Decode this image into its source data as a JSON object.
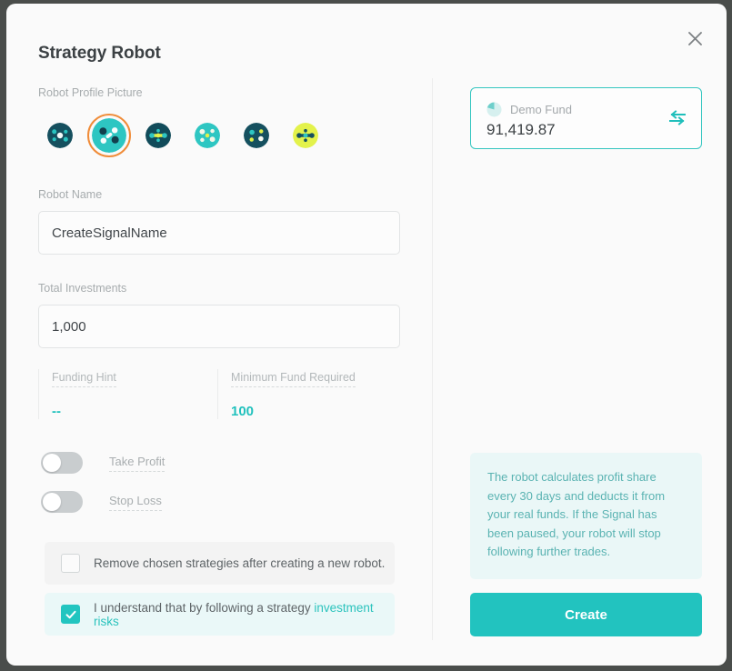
{
  "dialog": {
    "title": "Strategy Robot",
    "close_icon": "close-icon"
  },
  "left": {
    "avatar_section_label": "Robot Profile Picture",
    "avatars": [
      {
        "id": "avatar-1",
        "bg": "#154f5e",
        "dot": "#28c3c0",
        "selected": false
      },
      {
        "id": "avatar-2",
        "bg": "#2ec6c2",
        "dot": "#123f4d",
        "selected": true
      },
      {
        "id": "avatar-3",
        "bg": "#114b5a",
        "dot": "#e3f24b",
        "selected": false
      },
      {
        "id": "avatar-4",
        "bg": "#2ec6c2",
        "dot": "#f2f7a8",
        "selected": false
      },
      {
        "id": "avatar-5",
        "bg": "#15505f",
        "dot": "#dff04a",
        "selected": false
      },
      {
        "id": "avatar-6",
        "bg": "#e3f24b",
        "dot": "#15505f",
        "selected": false
      }
    ],
    "robot_name": {
      "label": "Robot Name",
      "value": "CreateSignalName",
      "placeholder": "Robot Name"
    },
    "total_investments": {
      "label": "Total Investments",
      "value": "1,000",
      "placeholder": "Total Investments"
    },
    "hints": [
      {
        "label": "Funding Hint",
        "value": "--"
      },
      {
        "label": "Minimum Fund Required",
        "value": "100"
      }
    ],
    "toggles": [
      {
        "label": "Take Profit",
        "on": false
      },
      {
        "label": "Stop Loss",
        "on": false
      }
    ],
    "checkboxes": [
      {
        "label": "Remove chosen strategies after creating a new robot.",
        "link": "",
        "checked": false
      },
      {
        "label": "I understand that by following a strategy ",
        "link": "investment risks",
        "checked": true
      }
    ]
  },
  "right": {
    "fund": {
      "icon": "fund-drop-icon",
      "name": "Demo Fund",
      "amount": "91,419.87",
      "swap_icon": "swap-arrows-icon"
    },
    "info_text": "The robot calculates profit share every 30 days and deducts it from your real funds. If the Signal has been paused, your robot will stop following further trades.",
    "create_label": "Create"
  },
  "colors": {
    "accent": "#22c3bf",
    "selected_ring": "#f08c39",
    "link": "#2bc3bd",
    "info_bg": "#eaf7f7",
    "info_text": "#5ab3b2"
  }
}
